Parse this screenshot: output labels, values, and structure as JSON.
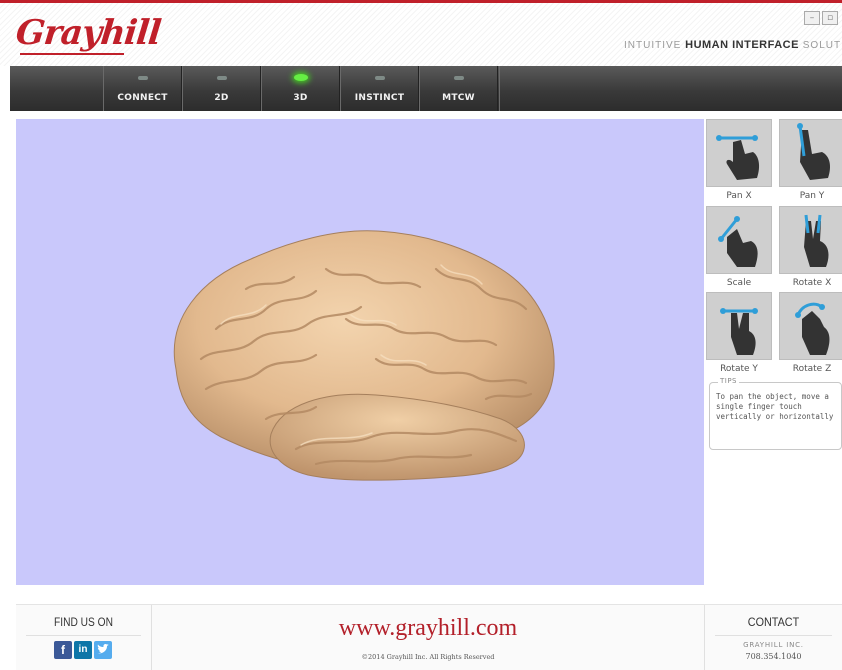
{
  "header": {
    "logo": "Grayhill",
    "tagline_left": "INTUITIVE",
    "tagline_mid": "HUMAN INTERFACE",
    "tagline_right": "SOLUTIONS",
    "window_controls": [
      "minimize-icon",
      "maximize-icon"
    ]
  },
  "nav": {
    "tabs": [
      {
        "label": "CONNECT",
        "active": false
      },
      {
        "label": "2D",
        "active": false
      },
      {
        "label": "3D",
        "active": true
      },
      {
        "label": "INSTINCT",
        "active": false
      },
      {
        "label": "MTCW",
        "active": false
      }
    ],
    "led_active_color": "#66ee44",
    "led_inactive_color": "#7e8a86"
  },
  "viewport": {
    "background_color": "#c9c8fb",
    "object": "brain-model"
  },
  "gestures": [
    {
      "label": "Pan X",
      "icon": "pan-x-gesture-icon"
    },
    {
      "label": "Pan Y",
      "icon": "pan-y-gesture-icon"
    },
    {
      "label": "Scale",
      "icon": "scale-gesture-icon"
    },
    {
      "label": "Rotate X",
      "icon": "rotate-x-gesture-icon"
    },
    {
      "label": "Rotate Y",
      "icon": "rotate-y-gesture-icon"
    },
    {
      "label": "Rotate Z",
      "icon": "rotate-z-gesture-icon"
    }
  ],
  "tips": {
    "title": "TIPS",
    "text": "To pan the object, move a single finger touch vertically or horizontally"
  },
  "footer": {
    "find_us_title": "FIND US ON",
    "social": [
      "facebook-icon",
      "linkedin-icon",
      "twitter-icon"
    ],
    "url": "www.grayhill.com",
    "copyright": "©2014 Grayhill Inc. All Rights Reserved",
    "contact_title": "CONTACT",
    "company": "GRAYHILL INC.",
    "phone": "708.354.1040"
  },
  "colors": {
    "brand_red": "#c0202a",
    "nav_dark": "#3a3a3a",
    "gesture_accent": "#2f9ed8"
  }
}
